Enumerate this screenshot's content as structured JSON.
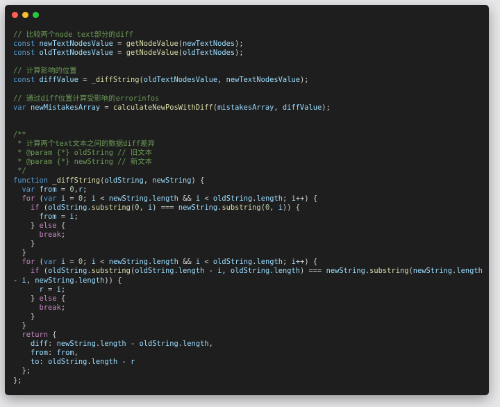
{
  "window": {
    "controls": [
      "close",
      "minimize",
      "maximize"
    ],
    "colors": {
      "background": "#1e1e1e",
      "comment": "#6a9955",
      "keyword": "#c586c0",
      "storage": "#569cd6",
      "function": "#dcdcaa",
      "variable": "#9cdcfe"
    }
  },
  "code": {
    "lines": [
      [
        {
          "t": "// 比较两个node text部分的diff",
          "c": "c"
        }
      ],
      [
        {
          "t": "const ",
          "c": "s"
        },
        {
          "t": "newTextNodesValue",
          "c": "v"
        },
        {
          "t": " = ",
          "c": "o"
        },
        {
          "t": "getNodeValue",
          "c": "f"
        },
        {
          "t": "(",
          "c": "o"
        },
        {
          "t": "newTextNodes",
          "c": "v"
        },
        {
          "t": ");",
          "c": "o"
        }
      ],
      [
        {
          "t": "const ",
          "c": "s"
        },
        {
          "t": "oldTextNodesValue",
          "c": "v"
        },
        {
          "t": " = ",
          "c": "o"
        },
        {
          "t": "getNodeValue",
          "c": "f"
        },
        {
          "t": "(",
          "c": "o"
        },
        {
          "t": "oldTextNodes",
          "c": "v"
        },
        {
          "t": ");",
          "c": "o"
        }
      ],
      [],
      [
        {
          "t": "// 计算影响的位置",
          "c": "c"
        }
      ],
      [
        {
          "t": "const ",
          "c": "s"
        },
        {
          "t": "diffValue",
          "c": "v"
        },
        {
          "t": " = ",
          "c": "o"
        },
        {
          "t": "_diffString",
          "c": "f"
        },
        {
          "t": "(",
          "c": "o"
        },
        {
          "t": "oldTextNodesValue",
          "c": "v"
        },
        {
          "t": ", ",
          "c": "o"
        },
        {
          "t": "newTextNodesValue",
          "c": "v"
        },
        {
          "t": ");",
          "c": "o"
        }
      ],
      [],
      [
        {
          "t": "// 通过diff位置计算受影响的errorinfos",
          "c": "c"
        }
      ],
      [
        {
          "t": "var ",
          "c": "s"
        },
        {
          "t": "newMistakesArray",
          "c": "v"
        },
        {
          "t": " = ",
          "c": "o"
        },
        {
          "t": "calculateNewPosWithDiff",
          "c": "f"
        },
        {
          "t": "(",
          "c": "o"
        },
        {
          "t": "mistakesArray",
          "c": "v"
        },
        {
          "t": ", ",
          "c": "o"
        },
        {
          "t": "diffValue",
          "c": "v"
        },
        {
          "t": ");",
          "c": "o"
        }
      ],
      [],
      [],
      [
        {
          "t": "/**",
          "c": "c"
        }
      ],
      [
        {
          "t": " * 计算两个text文本之间的数据diff差异",
          "c": "c"
        }
      ],
      [
        {
          "t": " * @param {*} oldString // 旧文本",
          "c": "c"
        }
      ],
      [
        {
          "t": " * @param {*} newString // 新文本",
          "c": "c"
        }
      ],
      [
        {
          "t": " */",
          "c": "c"
        }
      ],
      [
        {
          "t": "function ",
          "c": "s"
        },
        {
          "t": "_diffString",
          "c": "f"
        },
        {
          "t": "(",
          "c": "o"
        },
        {
          "t": "oldString",
          "c": "v"
        },
        {
          "t": ", ",
          "c": "o"
        },
        {
          "t": "newString",
          "c": "v"
        },
        {
          "t": ") {",
          "c": "o"
        }
      ],
      [
        {
          "t": "  var ",
          "c": "s"
        },
        {
          "t": "from",
          "c": "v"
        },
        {
          "t": " = ",
          "c": "o"
        },
        {
          "t": "0",
          "c": "n"
        },
        {
          "t": ",",
          "c": "o"
        },
        {
          "t": "r",
          "c": "v"
        },
        {
          "t": ";",
          "c": "o"
        }
      ],
      [
        {
          "t": "  for ",
          "c": "k"
        },
        {
          "t": "(",
          "c": "o"
        },
        {
          "t": "var ",
          "c": "s"
        },
        {
          "t": "i",
          "c": "v"
        },
        {
          "t": " = ",
          "c": "o"
        },
        {
          "t": "0",
          "c": "n"
        },
        {
          "t": "; ",
          "c": "o"
        },
        {
          "t": "i",
          "c": "v"
        },
        {
          "t": " < ",
          "c": "o"
        },
        {
          "t": "newString",
          "c": "v"
        },
        {
          "t": ".",
          "c": "o"
        },
        {
          "t": "length",
          "c": "v"
        },
        {
          "t": " && ",
          "c": "o"
        },
        {
          "t": "i",
          "c": "v"
        },
        {
          "t": " < ",
          "c": "o"
        },
        {
          "t": "oldString",
          "c": "v"
        },
        {
          "t": ".",
          "c": "o"
        },
        {
          "t": "length",
          "c": "v"
        },
        {
          "t": "; ",
          "c": "o"
        },
        {
          "t": "i",
          "c": "v"
        },
        {
          "t": "++) {",
          "c": "o"
        }
      ],
      [
        {
          "t": "    if ",
          "c": "k"
        },
        {
          "t": "(",
          "c": "o"
        },
        {
          "t": "oldString",
          "c": "v"
        },
        {
          "t": ".",
          "c": "o"
        },
        {
          "t": "substring",
          "c": "f"
        },
        {
          "t": "(",
          "c": "o"
        },
        {
          "t": "0",
          "c": "n"
        },
        {
          "t": ", ",
          "c": "o"
        },
        {
          "t": "i",
          "c": "v"
        },
        {
          "t": ") === ",
          "c": "o"
        },
        {
          "t": "newString",
          "c": "v"
        },
        {
          "t": ".",
          "c": "o"
        },
        {
          "t": "substring",
          "c": "f"
        },
        {
          "t": "(",
          "c": "o"
        },
        {
          "t": "0",
          "c": "n"
        },
        {
          "t": ", ",
          "c": "o"
        },
        {
          "t": "i",
          "c": "v"
        },
        {
          "t": ")) {",
          "c": "o"
        }
      ],
      [
        {
          "t": "      from",
          "c": "v"
        },
        {
          "t": " = ",
          "c": "o"
        },
        {
          "t": "i",
          "c": "v"
        },
        {
          "t": ";",
          "c": "o"
        }
      ],
      [
        {
          "t": "    } ",
          "c": "o"
        },
        {
          "t": "else",
          "c": "k"
        },
        {
          "t": " {",
          "c": "o"
        }
      ],
      [
        {
          "t": "      break",
          "c": "k"
        },
        {
          "t": ";",
          "c": "o"
        }
      ],
      [
        {
          "t": "    }",
          "c": "o"
        }
      ],
      [
        {
          "t": "  }",
          "c": "o"
        }
      ],
      [
        {
          "t": "  for ",
          "c": "k"
        },
        {
          "t": "(",
          "c": "o"
        },
        {
          "t": "var ",
          "c": "s"
        },
        {
          "t": "i",
          "c": "v"
        },
        {
          "t": " = ",
          "c": "o"
        },
        {
          "t": "0",
          "c": "n"
        },
        {
          "t": "; ",
          "c": "o"
        },
        {
          "t": "i",
          "c": "v"
        },
        {
          "t": " < ",
          "c": "o"
        },
        {
          "t": "newString",
          "c": "v"
        },
        {
          "t": ".",
          "c": "o"
        },
        {
          "t": "length",
          "c": "v"
        },
        {
          "t": " && ",
          "c": "o"
        },
        {
          "t": "i",
          "c": "v"
        },
        {
          "t": " < ",
          "c": "o"
        },
        {
          "t": "oldString",
          "c": "v"
        },
        {
          "t": ".",
          "c": "o"
        },
        {
          "t": "length",
          "c": "v"
        },
        {
          "t": "; ",
          "c": "o"
        },
        {
          "t": "i",
          "c": "v"
        },
        {
          "t": "++) {",
          "c": "o"
        }
      ],
      [
        {
          "t": "    if ",
          "c": "k"
        },
        {
          "t": "(",
          "c": "o"
        },
        {
          "t": "oldString",
          "c": "v"
        },
        {
          "t": ".",
          "c": "o"
        },
        {
          "t": "substring",
          "c": "f"
        },
        {
          "t": "(",
          "c": "o"
        },
        {
          "t": "oldString",
          "c": "v"
        },
        {
          "t": ".",
          "c": "o"
        },
        {
          "t": "length",
          "c": "v"
        },
        {
          "t": " - ",
          "c": "o"
        },
        {
          "t": "i",
          "c": "v"
        },
        {
          "t": ", ",
          "c": "o"
        },
        {
          "t": "oldString",
          "c": "v"
        },
        {
          "t": ".",
          "c": "o"
        },
        {
          "t": "length",
          "c": "v"
        },
        {
          "t": ") === ",
          "c": "o"
        },
        {
          "t": "newString",
          "c": "v"
        },
        {
          "t": ".",
          "c": "o"
        },
        {
          "t": "substring",
          "c": "f"
        },
        {
          "t": "(",
          "c": "o"
        },
        {
          "t": "newString",
          "c": "v"
        },
        {
          "t": ".",
          "c": "o"
        },
        {
          "t": "length",
          "c": "v"
        }
      ],
      [
        {
          "t": "- ",
          "c": "o"
        },
        {
          "t": "i",
          "c": "v"
        },
        {
          "t": ", ",
          "c": "o"
        },
        {
          "t": "newString",
          "c": "v"
        },
        {
          "t": ".",
          "c": "o"
        },
        {
          "t": "length",
          "c": "v"
        },
        {
          "t": ")) {",
          "c": "o"
        }
      ],
      [
        {
          "t": "      r",
          "c": "v"
        },
        {
          "t": " = ",
          "c": "o"
        },
        {
          "t": "i",
          "c": "v"
        },
        {
          "t": ";",
          "c": "o"
        }
      ],
      [
        {
          "t": "    } ",
          "c": "o"
        },
        {
          "t": "else",
          "c": "k"
        },
        {
          "t": " {",
          "c": "o"
        }
      ],
      [
        {
          "t": "      break",
          "c": "k"
        },
        {
          "t": ";",
          "c": "o"
        }
      ],
      [
        {
          "t": "    }",
          "c": "o"
        }
      ],
      [
        {
          "t": "  }",
          "c": "o"
        }
      ],
      [
        {
          "t": "  return",
          "c": "k"
        },
        {
          "t": " {",
          "c": "o"
        }
      ],
      [
        {
          "t": "    diff",
          "c": "v"
        },
        {
          "t": ": ",
          "c": "o"
        },
        {
          "t": "newString",
          "c": "v"
        },
        {
          "t": ".",
          "c": "o"
        },
        {
          "t": "length",
          "c": "v"
        },
        {
          "t": " - ",
          "c": "o"
        },
        {
          "t": "oldString",
          "c": "v"
        },
        {
          "t": ".",
          "c": "o"
        },
        {
          "t": "length",
          "c": "v"
        },
        {
          "t": ",",
          "c": "o"
        }
      ],
      [
        {
          "t": "    from",
          "c": "v"
        },
        {
          "t": ": ",
          "c": "o"
        },
        {
          "t": "from",
          "c": "v"
        },
        {
          "t": ",",
          "c": "o"
        }
      ],
      [
        {
          "t": "    to",
          "c": "v"
        },
        {
          "t": ": ",
          "c": "o"
        },
        {
          "t": "oldString",
          "c": "v"
        },
        {
          "t": ".",
          "c": "o"
        },
        {
          "t": "length",
          "c": "v"
        },
        {
          "t": " - ",
          "c": "o"
        },
        {
          "t": "r",
          "c": "v"
        }
      ],
      [
        {
          "t": "  };",
          "c": "o"
        }
      ],
      [
        {
          "t": "};",
          "c": "o"
        }
      ]
    ]
  }
}
